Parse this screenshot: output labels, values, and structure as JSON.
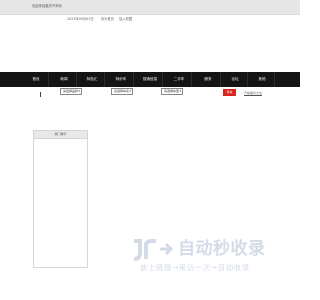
{
  "topbar": {
    "welcome": "欢迎来到重庆汽车网"
  },
  "date_row": {
    "date": "2023年09月03日",
    "link1": "设为首页",
    "link2": "加入收藏"
  },
  "nav": {
    "items": [
      "首页",
      "新闻",
      "特色汇",
      "特价车",
      "促销信息",
      "二手车",
      "服务",
      "论坛",
      "其他"
    ]
  },
  "filters": {
    "select1": "请选择品牌",
    "select2": "请选择车系",
    "select3": "请选择车型",
    "button": "找车",
    "link": "汽车报价大全"
  },
  "side_panel": {
    "header": "热门排行"
  },
  "watermark": {
    "title": "自动秒收录",
    "subtitle": "放上链接→来访一次→自动收录"
  },
  "colors": {
    "nav_bg": "#141414",
    "accent": "#d9251c",
    "watermark": "#d4dbe6"
  }
}
